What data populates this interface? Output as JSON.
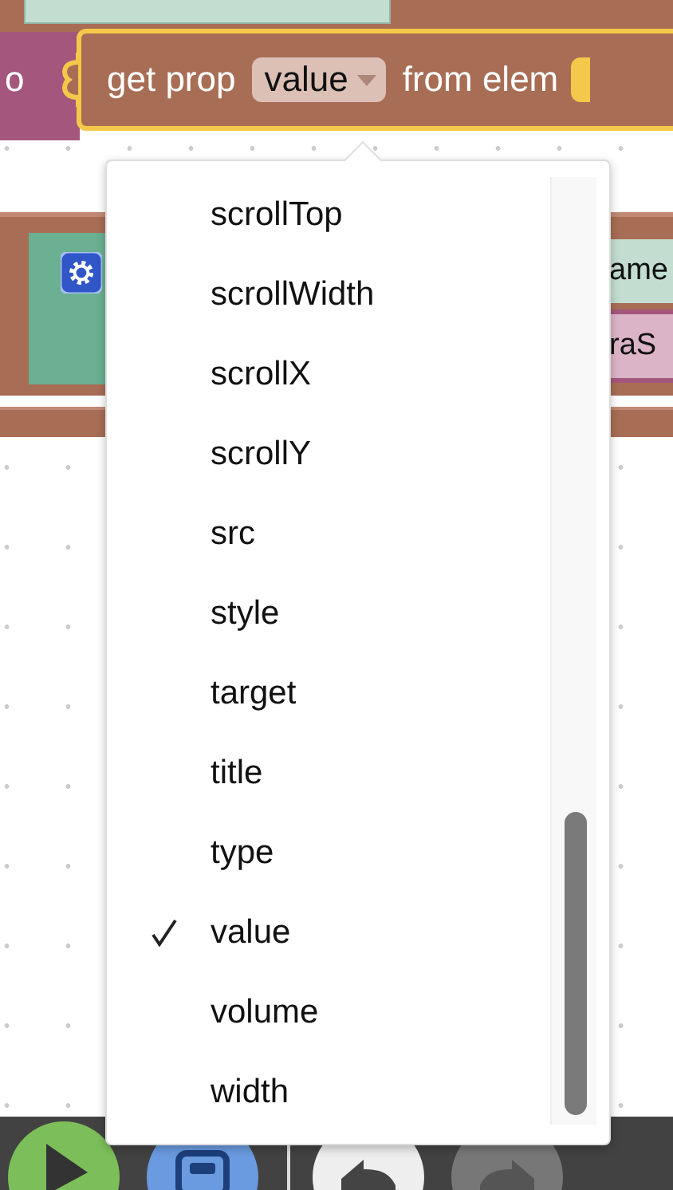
{
  "workspace": {
    "left_block_text": "o",
    "right_fields": [
      {
        "text": "ame",
        "kind": "green"
      },
      {
        "text": "raS",
        "kind": "pink"
      }
    ]
  },
  "block": {
    "prefix": "get prop",
    "field_value": "value",
    "suffix": "from elem"
  },
  "menu": {
    "items": [
      {
        "label": "scrollTop",
        "selected": false
      },
      {
        "label": "scrollWidth",
        "selected": false
      },
      {
        "label": "scrollX",
        "selected": false
      },
      {
        "label": "scrollY",
        "selected": false
      },
      {
        "label": "src",
        "selected": false
      },
      {
        "label": "style",
        "selected": false
      },
      {
        "label": "target",
        "selected": false
      },
      {
        "label": "title",
        "selected": false
      },
      {
        "label": "type",
        "selected": false
      },
      {
        "label": "value",
        "selected": true
      },
      {
        "label": "volume",
        "selected": false
      },
      {
        "label": "width",
        "selected": false
      }
    ]
  }
}
